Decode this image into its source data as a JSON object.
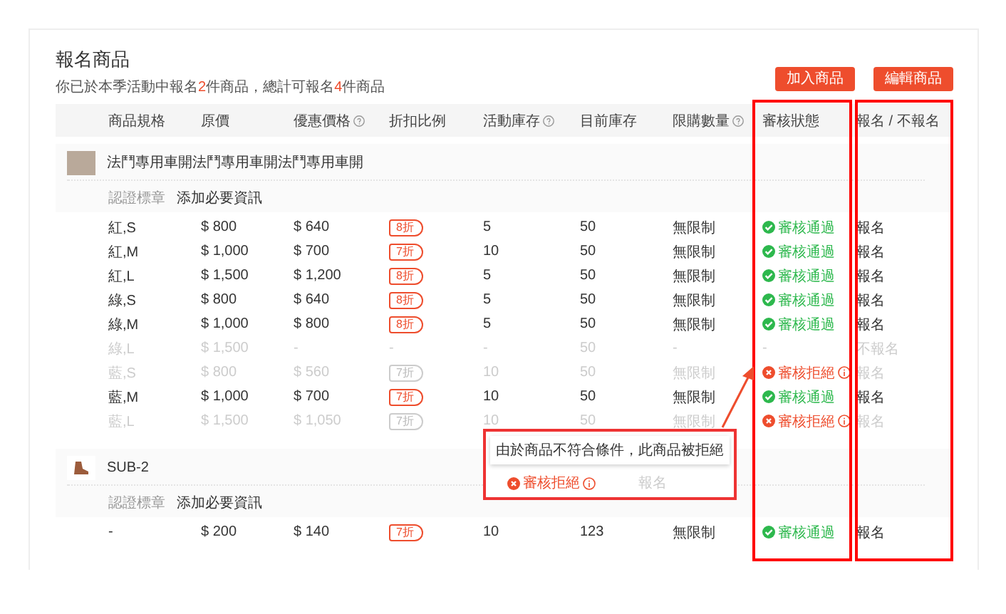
{
  "title": "報名商品",
  "subtitle": "你已於本季活動中報名**2**件商品，總計可報名**4**件商品",
  "buttons": [
    "加入商品",
    "編輯商品"
  ],
  "columns": [
    {
      "label": "商品規格",
      "help": false
    },
    {
      "label": "原價",
      "help": false
    },
    {
      "label": "優惠價格",
      "help": true
    },
    {
      "label": "折扣比例",
      "help": false
    },
    {
      "label": "活動庫存",
      "help": true
    },
    {
      "label": "目前庫存",
      "help": false
    },
    {
      "label": "限購數量",
      "help": true
    },
    {
      "label": "審核狀態",
      "help": false
    },
    {
      "label": "報名 / 不報名",
      "help": false
    }
  ],
  "groups": [
    {
      "name": "法鬥專用車開法鬥專用車開法鬥專用車開",
      "kind": "photo",
      "meta": [
        "認證標章",
        "添加必要資訊"
      ],
      "rows": [
        {
          "enabled": true,
          "spec": "紅,S",
          "price": "$ 800",
          "promo": "$ 640",
          "discount": {
            "kind": "tag",
            "text": "8折"
          },
          "stock": "5",
          "current": "50",
          "limit": "無限制",
          "status": {
            "kind": "approved",
            "text": "審核通過",
            "info": false
          },
          "action": "報名"
        },
        {
          "enabled": true,
          "spec": "紅,M",
          "price": "$ 1,000",
          "promo": "$ 700",
          "discount": {
            "kind": "tag",
            "text": "7折"
          },
          "stock": "10",
          "current": "50",
          "limit": "無限制",
          "status": {
            "kind": "approved",
            "text": "審核通過",
            "info": false
          },
          "action": "報名"
        },
        {
          "enabled": true,
          "spec": "紅,L",
          "price": "$ 1,500",
          "promo": "$ 1,200",
          "discount": {
            "kind": "tag",
            "text": "8折"
          },
          "stock": "5",
          "current": "50",
          "limit": "無限制",
          "status": {
            "kind": "approved",
            "text": "審核通過",
            "info": false
          },
          "action": "報名"
        },
        {
          "enabled": true,
          "spec": "綠,S",
          "price": "$ 800",
          "promo": "$ 640",
          "discount": {
            "kind": "tag",
            "text": "8折"
          },
          "stock": "5",
          "current": "50",
          "limit": "無限制",
          "status": {
            "kind": "approved",
            "text": "審核通過",
            "info": false
          },
          "action": "報名"
        },
        {
          "enabled": true,
          "spec": "綠,M",
          "price": "$ 1,000",
          "promo": "$ 800",
          "discount": {
            "kind": "tag",
            "text": "8折"
          },
          "stock": "5",
          "current": "50",
          "limit": "無限制",
          "status": {
            "kind": "approved",
            "text": "審核通過",
            "info": false
          },
          "action": "報名"
        },
        {
          "enabled": false,
          "spec": "綠,L",
          "price": "$ 1,500",
          "promo": "-",
          "discount": {
            "kind": "plain",
            "text": "-"
          },
          "stock": "-",
          "current": "50",
          "limit": "-",
          "status": {
            "kind": "none",
            "text": "-",
            "info": false
          },
          "action": "不報名"
        },
        {
          "enabled": false,
          "spec": "藍,S",
          "price": "$ 800",
          "promo": "$ 560",
          "discount": {
            "kind": "tag",
            "text": "7折"
          },
          "stock": "10",
          "current": "50",
          "limit": "無限制",
          "status": {
            "kind": "rejected",
            "text": "審核拒絕",
            "info": true
          },
          "action": "報名"
        },
        {
          "enabled": true,
          "spec": "藍,M",
          "price": "$ 1,000",
          "promo": "$ 700",
          "discount": {
            "kind": "tag",
            "text": "7折"
          },
          "stock": "10",
          "current": "50",
          "limit": "無限制",
          "status": {
            "kind": "approved",
            "text": "審核通過",
            "info": false
          },
          "action": "報名"
        },
        {
          "enabled": false,
          "spec": "藍,L",
          "price": "$ 1,500",
          "promo": "$ 1,050",
          "discount": {
            "kind": "tag",
            "text": "7折"
          },
          "stock": "10",
          "current": "50",
          "limit": "無限制",
          "status": {
            "kind": "rejected",
            "text": "審核拒絕",
            "info": true
          },
          "action": "報名"
        }
      ]
    },
    {
      "name": "SUB-2",
      "kind": "boot",
      "meta": [
        "認證標章",
        "添加必要資訊"
      ],
      "rows": [
        {
          "enabled": true,
          "spec": "-",
          "price": "$ 200",
          "promo": "$ 140",
          "discount": {
            "kind": "tag",
            "text": "7折"
          },
          "stock": "10",
          "current": "123",
          "limit": "無限制",
          "status": {
            "kind": "approved",
            "text": "審核通過",
            "info": false
          },
          "action": "報名"
        }
      ]
    }
  ],
  "callout": {
    "text": "由於商品不符合條件，此商品被拒絕",
    "status": {
      "kind": "rejected",
      "text": "審核拒絕",
      "info": true
    },
    "action": "報名"
  }
}
